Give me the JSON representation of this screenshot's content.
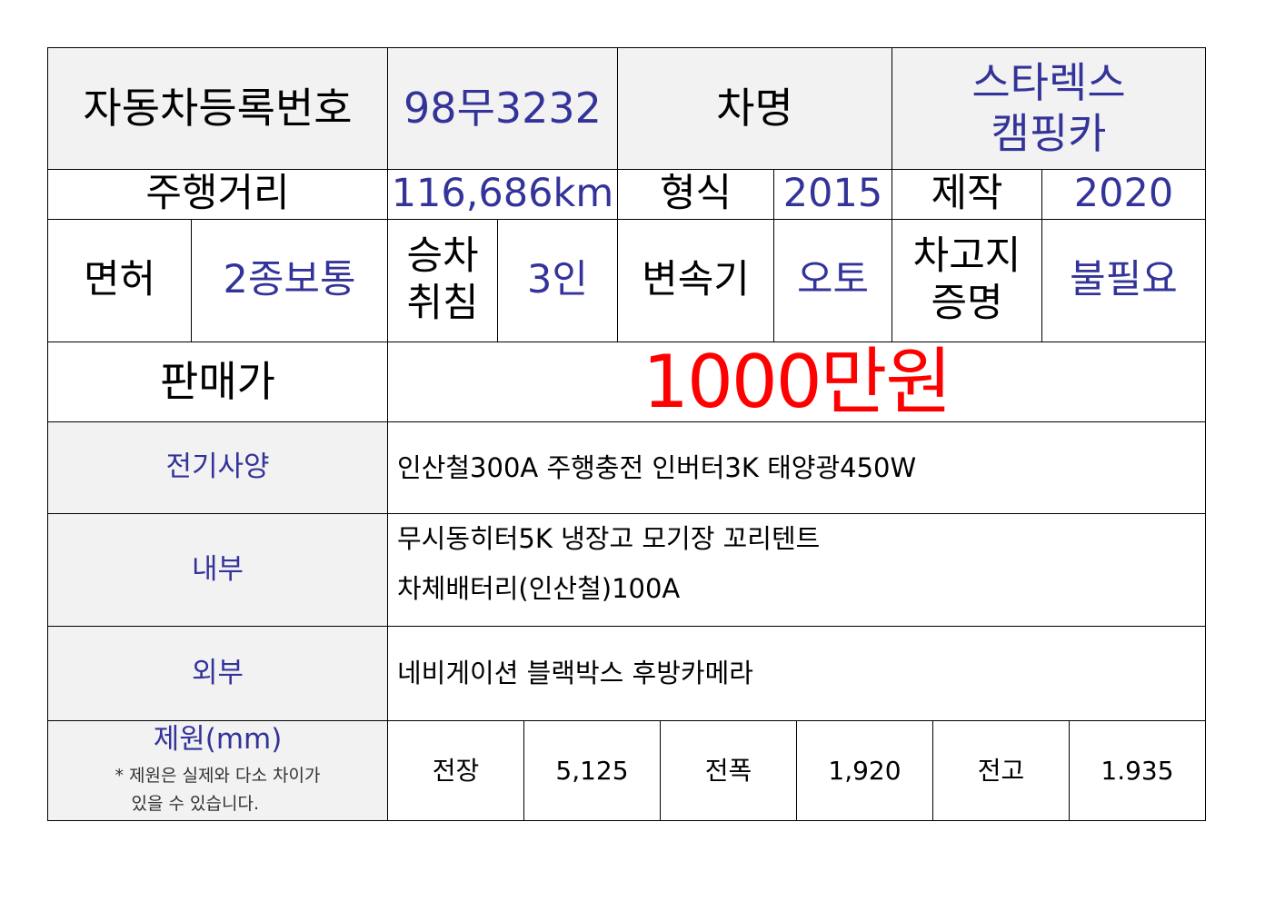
{
  "header": {
    "reg_label": "자동차등록번호",
    "reg_value": "98무3232",
    "name_label": "차명",
    "name_value_line1": "스타렉스",
    "name_value_line2": "캠핑카"
  },
  "row2": {
    "mileage_label": "주행거리",
    "mileage_value": "116,686km",
    "model_label": "형식",
    "model_value": "2015",
    "made_label": "제작",
    "made_value": "2020"
  },
  "row3": {
    "license_label": "면허",
    "license_value": "2종보통",
    "seats_label_line1": "승차",
    "seats_label_line2": "취침",
    "seats_value": "3인",
    "trans_label": "변속기",
    "trans_value": "오토",
    "garage_label_line1": "차고지",
    "garage_label_line2": "증명",
    "garage_value": "불필요"
  },
  "price": {
    "label": "판매가",
    "value": "1000만원"
  },
  "electric": {
    "label": "전기사양",
    "value": "인산철300A 주행충전 인버터3K 태양광450W"
  },
  "interior": {
    "label": "내부",
    "line1": "무시동히터5K 냉장고 모기장 꼬리텐트",
    "line2": "차체배터리(인산철)100A"
  },
  "exterior": {
    "label": "외부",
    "value": "네비게이션 블랙박스 후방카메라"
  },
  "specs": {
    "label": "제원(mm)",
    "note_line1": "* 제원은 실제와 다소 차이가",
    "note_line2": "있을 수 있습니다.",
    "length_label": "전장",
    "length_value": "5,125",
    "width_label": "전폭",
    "width_value": "1,920",
    "height_label": "전고",
    "height_value": "1.935"
  },
  "colors": {
    "value_text": "#333399",
    "price_text": "#ff0000",
    "label_bg": "#f2f2f2"
  }
}
